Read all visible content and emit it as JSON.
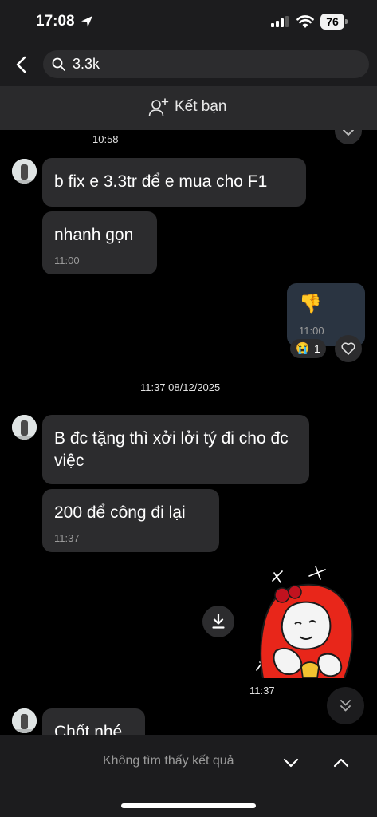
{
  "status_bar": {
    "time": "17:08",
    "battery": "76"
  },
  "search": {
    "query": "3.3k"
  },
  "friend_bar": {
    "label": "Kết bạn"
  },
  "messages": {
    "time_top": "10:58",
    "m1": "b fix e 3.3tr để e mua cho F1",
    "m2": "nhanh gọn",
    "m2_time": "11:00",
    "sent_emoji": "👎",
    "sent_time": "11:00",
    "reaction_emoji": "😭",
    "reaction_count": "1",
    "date_divider": "11:37 08/12/2025",
    "m3": "B đc tặng thì xởi lởi tý đi cho đc việc",
    "m4": "200 để công đi lại",
    "m4_time": "11:37",
    "sticker_time": "11:37",
    "m5": "Chốt nhé"
  },
  "bottom_bar": {
    "no_result": "Không tìm thấy kết quả"
  },
  "colors": {
    "background": "#000000",
    "bubble": "#2c2c2e",
    "bar": "#1c1c1e",
    "sticker_red": "#e8261a"
  }
}
